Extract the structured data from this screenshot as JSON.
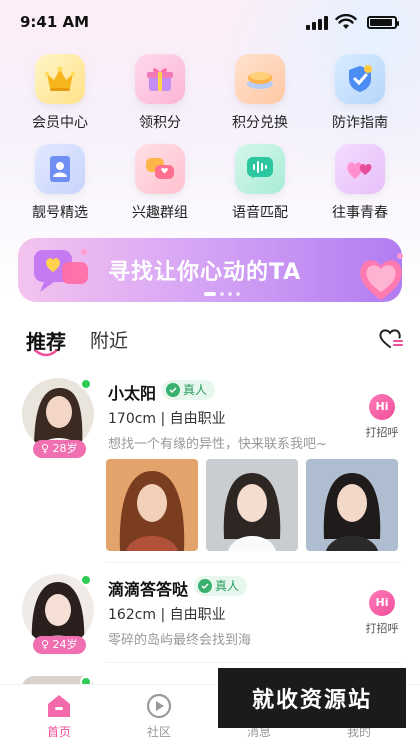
{
  "status_bar": {
    "time": "9:41 AM"
  },
  "features": [
    {
      "label": "会员中心",
      "icon": "crown-icon"
    },
    {
      "label": "领积分",
      "icon": "gift-box-icon"
    },
    {
      "label": "积分兑换",
      "icon": "exchange-icon"
    },
    {
      "label": "防诈指南",
      "icon": "shield-icon"
    },
    {
      "label": "靓号精选",
      "icon": "id-card-icon"
    },
    {
      "label": "兴趣群组",
      "icon": "group-chat-icon"
    },
    {
      "label": "语音匹配",
      "icon": "voice-wave-icon"
    },
    {
      "label": "往事青春",
      "icon": "hearts-icon"
    }
  ],
  "banner": {
    "text": "寻找让你心动的TA"
  },
  "tabs": {
    "recommend": "推荐",
    "nearby": "附近"
  },
  "users": [
    {
      "name": "小太阳",
      "real_tag": "真人",
      "age": "♀ 28岁",
      "meta": "170cm | 自由职业",
      "bio": "想找一个有缘的异性，快来联系我吧~",
      "greet": "打招呼",
      "hi": "Hi"
    },
    {
      "name": "滴滴答答哒",
      "real_tag": "真人",
      "age": "♀ 24岁",
      "meta": "162cm | 自由职业",
      "bio": "零碎的岛屿最终会找到海",
      "greet": "打招呼",
      "hi": "Hi"
    }
  ],
  "tabbar": [
    {
      "label": "首页",
      "icon": "home-icon",
      "active": true
    },
    {
      "label": "社区",
      "icon": "community-icon"
    },
    {
      "label": "消息",
      "icon": "message-icon"
    },
    {
      "label": "我的",
      "icon": "profile-icon"
    }
  ],
  "watermark": "就收资源站",
  "colors": {
    "accent": "#f04e9a",
    "online": "#2ecc54",
    "banner_start": "#f4c4ef",
    "banner_end": "#b27cf1"
  }
}
